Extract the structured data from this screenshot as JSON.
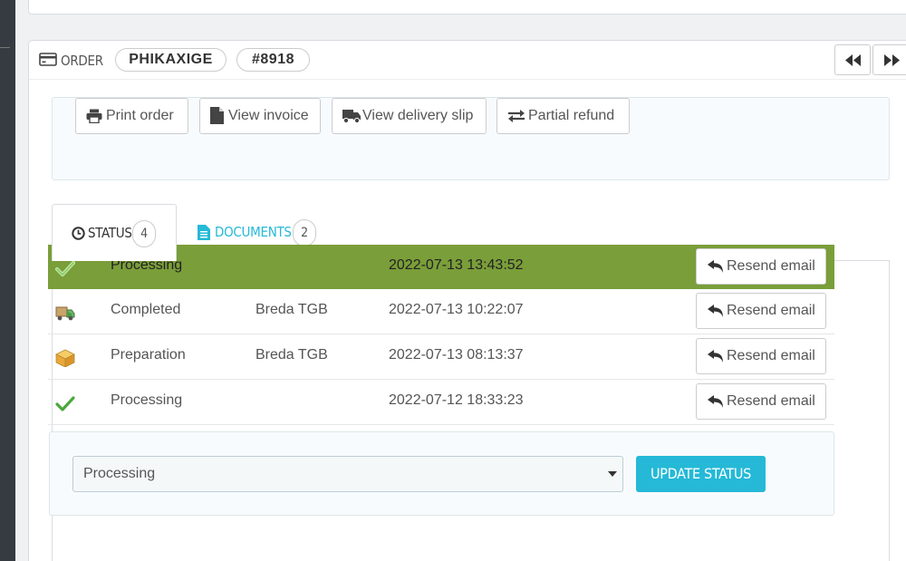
{
  "header": {
    "title": "ORDER",
    "reference": "PHIKAXIGE",
    "order_id": "#8918"
  },
  "actions": {
    "print": "Print order",
    "invoice": "View invoice",
    "delivery_slip": "View delivery slip",
    "partial_refund": "Partial refund"
  },
  "tabs": {
    "status": {
      "label": "STATUS",
      "count": "4"
    },
    "documents": {
      "label": "DOCUMENTS",
      "count": "2"
    }
  },
  "history": [
    {
      "icon": "check-icon",
      "status": "Processing",
      "employee": "",
      "date": "2022-07-13 13:43:52",
      "action": "Resend email",
      "active": true
    },
    {
      "icon": "truck-icon",
      "status": "Completed",
      "employee": "Breda TGB",
      "date": "2022-07-13 10:22:07",
      "action": "Resend email"
    },
    {
      "icon": "package-icon",
      "status": "Preparation",
      "employee": "Breda TGB",
      "date": "2022-07-13 08:13:37",
      "action": "Resend email"
    },
    {
      "icon": "check-icon",
      "status": "Processing",
      "employee": "",
      "date": "2022-07-12 18:33:23",
      "action": "Resend email"
    }
  ],
  "update": {
    "selected_status": "Processing",
    "button_label": "UPDATE STATUS"
  },
  "colors": {
    "active_row": "#7a9e39",
    "accent": "#25b9d7"
  }
}
